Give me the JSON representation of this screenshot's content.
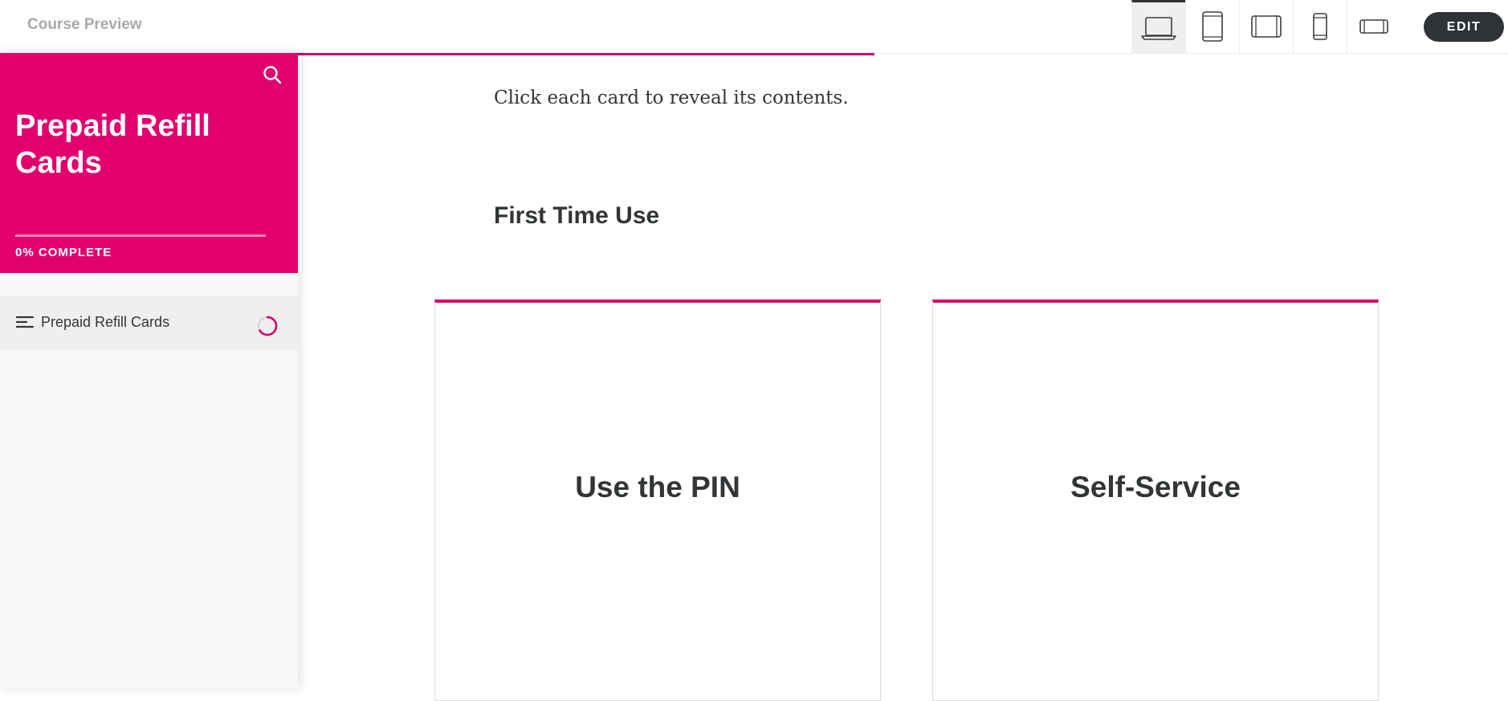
{
  "app": {
    "title": "Course Preview",
    "edit_label": "EDIT",
    "devices": [
      {
        "name": "desktop",
        "icon": "laptop-icon",
        "active": true
      },
      {
        "name": "tablet-portrait",
        "icon": "tablet-portrait-icon",
        "active": false
      },
      {
        "name": "tablet-landscape",
        "icon": "tablet-landscape-icon",
        "active": false
      },
      {
        "name": "phone-portrait",
        "icon": "phone-portrait-icon",
        "active": false
      },
      {
        "name": "phone-landscape",
        "icon": "phone-landscape-icon",
        "active": false
      }
    ],
    "top_progress": 0.58
  },
  "sidebar": {
    "course_title": "Prepaid Refill Cards",
    "progress_text": "0% COMPLETE",
    "progress_value": 0,
    "search_icon": "search-icon",
    "lessons": [
      {
        "label": "Prepaid Refill Cards",
        "icon": "menu-lines-icon",
        "status_icon": "loading-ring-icon"
      }
    ]
  },
  "main": {
    "instruction": "Click each card to reveal its contents.",
    "section_heading": "First Time Use",
    "cards": [
      {
        "title": "Use the PIN"
      },
      {
        "title": "Self-Service"
      }
    ]
  },
  "colors": {
    "accent": "#e2006e",
    "accent_line": "#d30069",
    "dark": "#2f3337",
    "muted_text": "#a9a9a9"
  }
}
